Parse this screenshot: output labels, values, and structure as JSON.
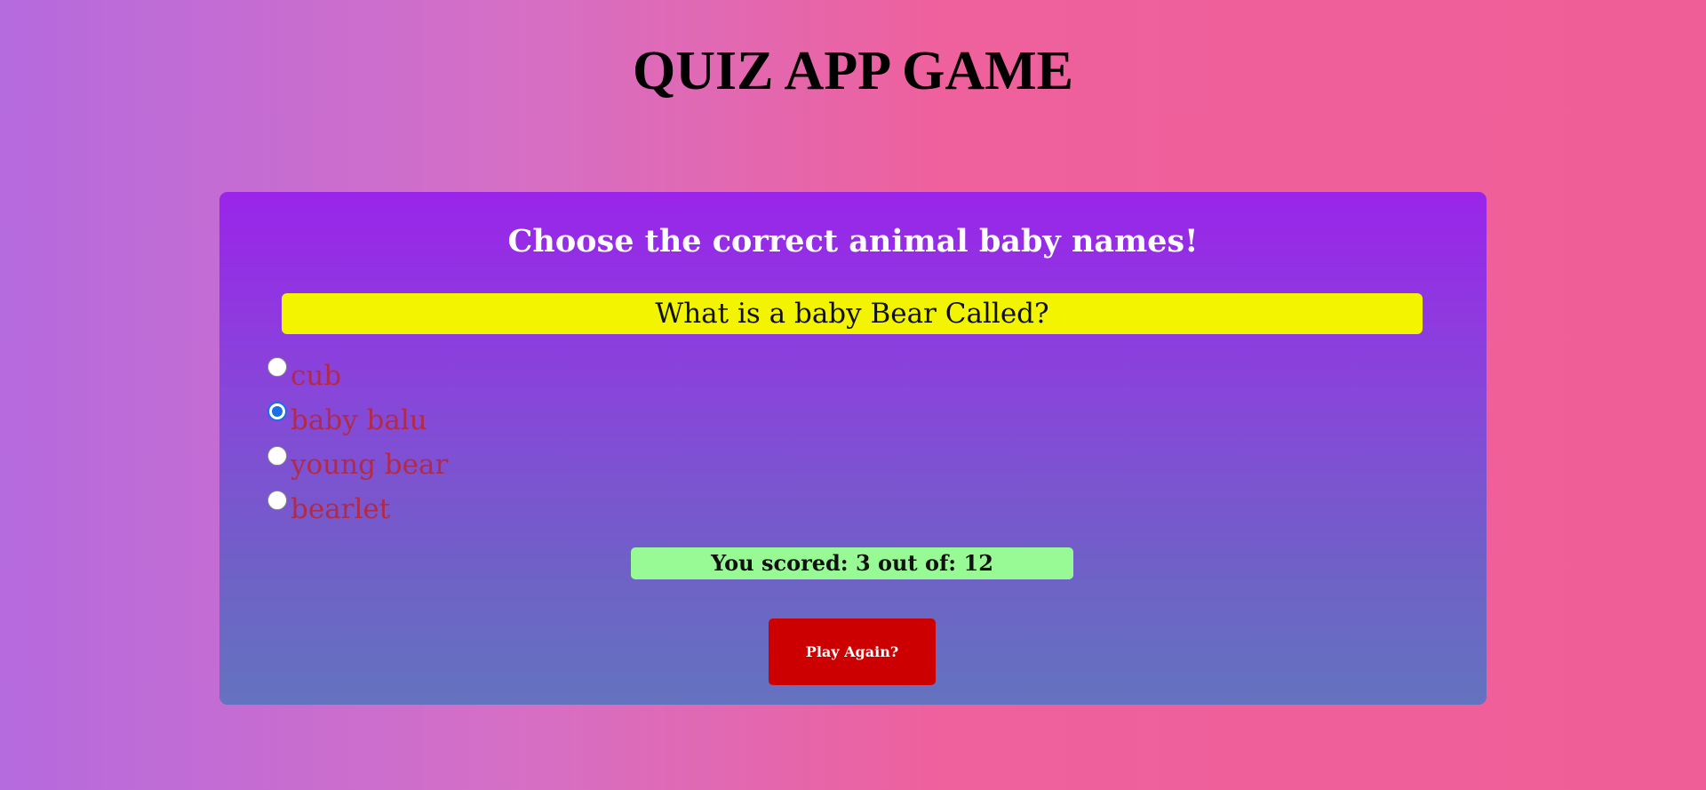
{
  "app": {
    "title": "QUIZ APP GAME"
  },
  "quiz": {
    "heading": "Choose the correct animal baby names!",
    "question": "What is a baby Bear Called?",
    "options": [
      {
        "label": "cub",
        "selected": false
      },
      {
        "label": "baby balu",
        "selected": true
      },
      {
        "label": "young bear",
        "selected": false
      },
      {
        "label": "bearlet",
        "selected": false
      }
    ],
    "score_text": "You scored: 3 out of: 12",
    "play_again_label": "Play Again?"
  },
  "colors": {
    "question_bg": "#f3f500",
    "score_bg": "#98fa94",
    "button_bg": "#cc0000",
    "option_text": "#b22a4a",
    "radio_checked": "#1a6fe8"
  }
}
